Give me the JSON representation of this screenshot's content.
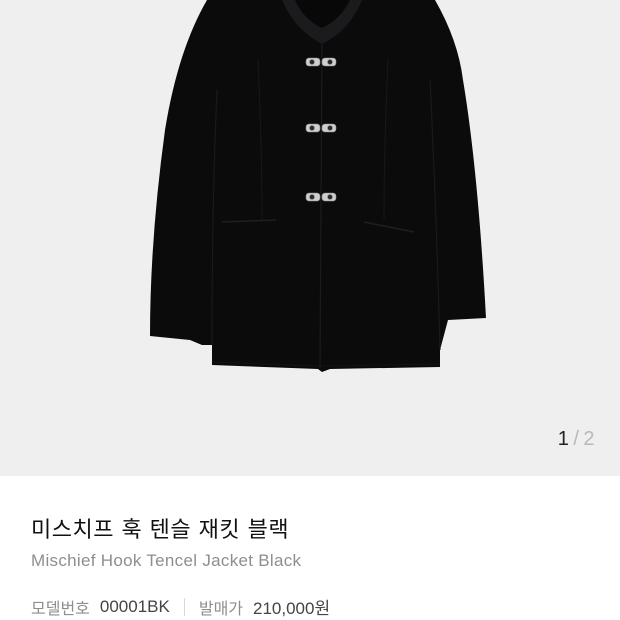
{
  "gallery": {
    "current_page": "1",
    "separator": "/",
    "total_pages": "2",
    "image": {
      "subject": "black-collarless-jacket-with-silver-hook-closures",
      "background_color": "#efefef",
      "garment_color": "#0b0b0c",
      "hardware_color": "#c9c9c9"
    }
  },
  "product": {
    "name_ko": "미스치프 훅 텐슬 재킷 블랙",
    "name_en": "Mischief Hook Tencel Jacket Black",
    "model_label": "모델번호",
    "model_value": "00001BK",
    "price_label": "발매가",
    "price_value": "210,000원"
  }
}
